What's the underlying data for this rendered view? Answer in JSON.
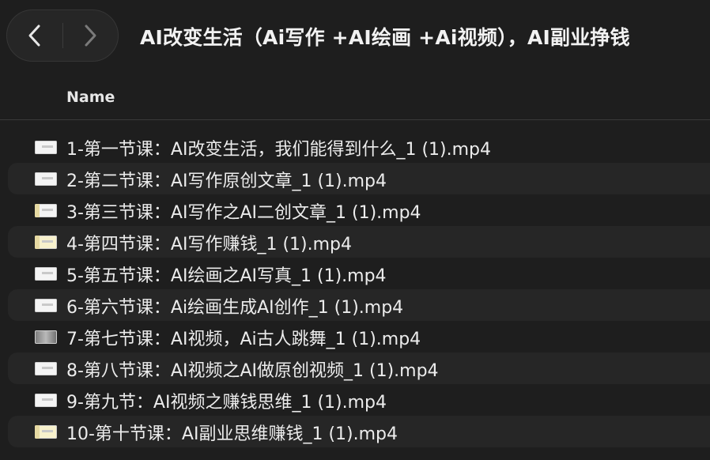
{
  "window": {
    "title": "AI改变生活（Ai写作 +AI绘画 +Ai视频），AI副业挣钱"
  },
  "toolbar": {
    "back_icon": "chevron-left-icon",
    "forward_icon": "chevron-right-icon"
  },
  "columns": {
    "name_header": "Name"
  },
  "files": [
    {
      "name": "1-第一节课：AI改变生活，我们能得到什么_1 (1).mp4",
      "icon": "video-file-icon"
    },
    {
      "name": "2-第二节课：AI写作原创文章_1 (1).mp4",
      "icon": "video-file-icon"
    },
    {
      "name": "3-第三节课：AI写作之AI二创文章_1 (1).mp4",
      "icon": "video-file-icon"
    },
    {
      "name": "4-第四节课：AI写作赚钱_1 (1).mp4",
      "icon": "video-file-icon"
    },
    {
      "name": "5-第五节课：AI绘画之AI写真_1 (1).mp4",
      "icon": "video-file-icon"
    },
    {
      "name": "6-第六节课：Ai绘画生成AI创作_1 (1).mp4",
      "icon": "video-file-icon"
    },
    {
      "name": "7-第七节课：AI视频，Ai古人跳舞_1 (1).mp4",
      "icon": "video-file-icon"
    },
    {
      "name": "8-第八节课：AI视频之AI做原创视频_1 (1).mp4",
      "icon": "video-file-icon"
    },
    {
      "name": "9-第九节：AI视频之赚钱思维_1 (1).mp4",
      "icon": "video-file-icon"
    },
    {
      "name": "10-第十节课：AI副业思维赚钱_1 (1).mp4",
      "icon": "video-file-icon"
    }
  ],
  "colors": {
    "background": "#1e1e1e",
    "row_alt": "#262626",
    "text": "#ececec"
  }
}
